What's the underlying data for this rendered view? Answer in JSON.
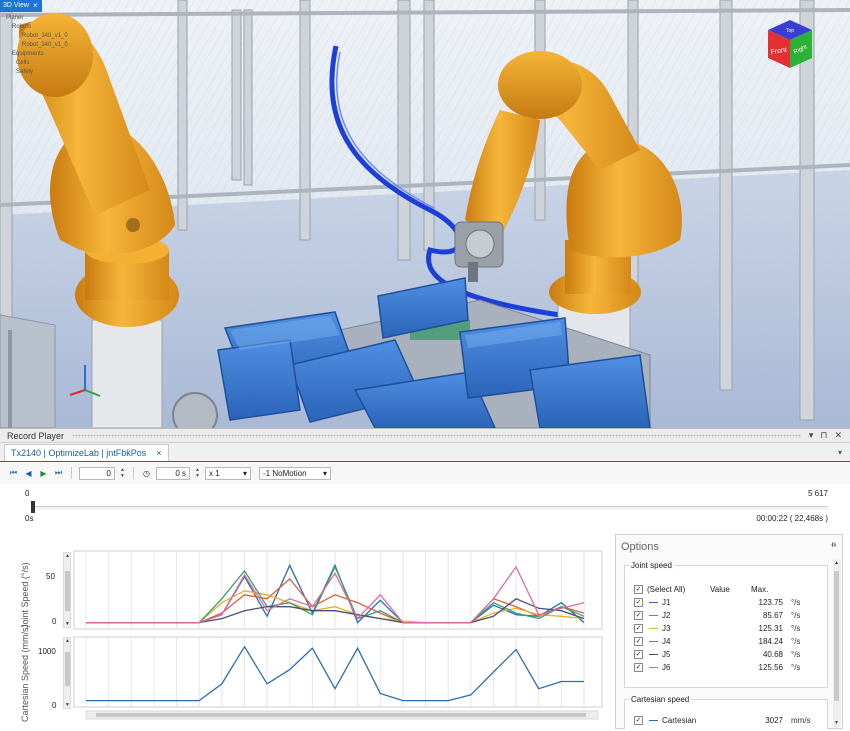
{
  "viewport": {
    "tab_label": "3D View",
    "tab_close": "×",
    "tree": [
      "Planer",
      "Robots",
      "Robot_340_v1_0",
      "Robot_340_v1_0",
      "Equipments",
      "Cells",
      "Safety"
    ],
    "view_cube": {
      "top": "Top",
      "front": "Front",
      "right": "Right"
    }
  },
  "player": {
    "title": "Record Player",
    "title_icons": {
      "dropdown": "▾",
      "pin": "⊓",
      "close": "✕"
    },
    "doc_tab": "Tx2140 | OptimizeLab | jntFbkPos",
    "doc_tab_close": "×",
    "tabs_menu": "▾",
    "toolbar": {
      "frame_value": "0",
      "time_value": "0 s",
      "speed_value": "x 1",
      "motion_value": "-1 NoMotion"
    },
    "timeline": {
      "start_frame": "0",
      "end_frame": "5 617",
      "start_time": "0s",
      "end_time": "00:00:22 ( 22,468s )"
    },
    "joint_chart": {
      "ylabel": "Joint Speed (°/s)",
      "ticks": [
        "50",
        "0"
      ]
    },
    "cart_chart": {
      "ylabel": "Cartesian Speed (mm/s)",
      "ticks": [
        "1000",
        "0"
      ]
    }
  },
  "options": {
    "title": "Options",
    "pin": "ᵰ",
    "joint_group": {
      "label": "Joint speed",
      "headers": {
        "name": "(Select All)",
        "value": "Value",
        "max": "Max."
      },
      "rows": [
        {
          "name": "J1",
          "max": "123.75",
          "unit": "°/s",
          "color": "#2b6db5"
        },
        {
          "name": "J2",
          "max": "85.67",
          "unit": "°/s",
          "color": "#e05a3a"
        },
        {
          "name": "J3",
          "max": "125.31",
          "unit": "°/s",
          "color": "#e2b22a"
        },
        {
          "name": "J4",
          "max": "184.24",
          "unit": "°/s",
          "color": "#37a06a"
        },
        {
          "name": "J5",
          "max": "40.68",
          "unit": "°/s",
          "color": "#4a4f78"
        },
        {
          "name": "J6",
          "max": "125.56",
          "unit": "°/s",
          "color": "#e06aa0"
        }
      ]
    },
    "cart_group": {
      "label": "Cartesian speed",
      "rows": [
        {
          "name": "Cartesian",
          "max": "3027",
          "unit": "mm/s",
          "color": "#2b6db5"
        }
      ]
    }
  },
  "chart_data": [
    {
      "type": "line",
      "ylabel": "Joint Speed (°/s)",
      "x": [
        0,
        1,
        2,
        3,
        4,
        5,
        6,
        7,
        8,
        9,
        10,
        11,
        12,
        13,
        14,
        15,
        16,
        17,
        18,
        19,
        20,
        21,
        22
      ],
      "ylim": [
        -3,
        85
      ],
      "series": [
        {
          "name": "J1",
          "color": "#2b6db5",
          "values": [
            0,
            0,
            0,
            0,
            0,
            0,
            10,
            58,
            8,
            72,
            12,
            72,
            0,
            28,
            0,
            0,
            0,
            0,
            22,
            10,
            8,
            25,
            0
          ]
        },
        {
          "name": "J2",
          "color": "#e05a3a",
          "values": [
            0,
            0,
            0,
            0,
            0,
            0,
            12,
            35,
            30,
            55,
            20,
            35,
            25,
            12,
            0,
            0,
            0,
            0,
            30,
            20,
            8,
            20,
            12
          ]
        },
        {
          "name": "J3",
          "color": "#e2b22a",
          "values": [
            0,
            0,
            0,
            0,
            0,
            0,
            25,
            40,
            35,
            25,
            15,
            20,
            10,
            5,
            2,
            0,
            0,
            0,
            12,
            18,
            10,
            8,
            5
          ]
        },
        {
          "name": "J4",
          "color": "#37a06a",
          "values": [
            0,
            0,
            0,
            0,
            0,
            0,
            30,
            65,
            20,
            25,
            10,
            70,
            5,
            15,
            0,
            0,
            0,
            0,
            25,
            12,
            5,
            20,
            8
          ]
        },
        {
          "name": "J5",
          "color": "#4a4f78",
          "values": [
            0,
            0,
            0,
            0,
            0,
            0,
            5,
            15,
            20,
            20,
            15,
            15,
            10,
            5,
            0,
            0,
            0,
            0,
            8,
            30,
            18,
            15,
            5
          ]
        },
        {
          "name": "J6",
          "color": "#e06aa0",
          "values": [
            0,
            0,
            0,
            0,
            0,
            0,
            10,
            60,
            15,
            30,
            20,
            62,
            5,
            35,
            0,
            0,
            0,
            0,
            30,
            70,
            10,
            18,
            25
          ]
        }
      ]
    },
    {
      "type": "line",
      "ylabel": "Cartesian Speed (mm/s)",
      "x": [
        0,
        1,
        2,
        3,
        4,
        5,
        6,
        7,
        8,
        9,
        10,
        11,
        12,
        13,
        14,
        15,
        16,
        17,
        18,
        19,
        20,
        21,
        22
      ],
      "ylim": [
        -50,
        1250
      ],
      "series": [
        {
          "name": "Cartesian",
          "color": "#2b6db5",
          "values": [
            0,
            0,
            0,
            0,
            0,
            0,
            350,
            1130,
            350,
            650,
            1100,
            250,
            1100,
            150,
            0,
            0,
            0,
            120,
            600,
            1070,
            250,
            400,
            400
          ]
        }
      ]
    }
  ]
}
